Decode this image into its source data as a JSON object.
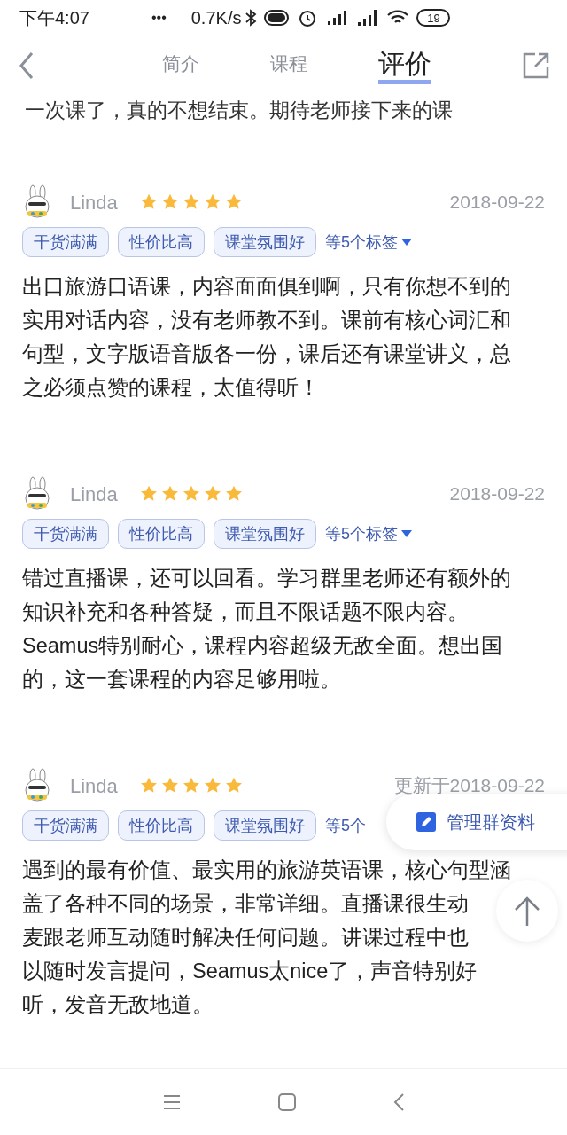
{
  "status_bar": {
    "time": "下午4:07",
    "dots": "•••",
    "speed": "0.7K/s",
    "battery": "19"
  },
  "header": {
    "tabs": [
      {
        "label": "简介",
        "selected": false
      },
      {
        "label": "课程",
        "selected": false
      },
      {
        "label": "评价",
        "selected": true
      }
    ]
  },
  "partial_review": {
    "text": "一次课了，真的不想结束。期待老师接下来的课"
  },
  "reviews": [
    {
      "user": "Linda",
      "stars": 5,
      "date": "2018-09-22",
      "tags": [
        "干货满满",
        "性价比高",
        "课堂氛围好"
      ],
      "more_tags": "等5个标签",
      "lines": [
        "出口旅游口语课，内容面面俱到啊，只有你想不到的",
        "实用对话内容，没有老师教不到。课前有核心词汇和",
        "句型，文字版语音版各一份，课后还有课堂讲义，总",
        "之必须点赞的课程，太值得听！"
      ]
    },
    {
      "user": "Linda",
      "stars": 5,
      "date": "2018-09-22",
      "tags": [
        "干货满满",
        "性价比高",
        "课堂氛围好"
      ],
      "more_tags": "等5个标签",
      "lines": [
        "错过直播课，还可以回看。学习群里老师还有额外的",
        "知识补充和各种答疑，而且不限话题不限内容。",
        "Seamus特别耐心，课程内容超级无敌全面。想出国",
        "的，这一套课程的内容足够用啦。"
      ]
    },
    {
      "user": "Linda",
      "stars": 5,
      "date": "更新于2018-09-22",
      "tags": [
        "干货满满",
        "性价比高",
        "课堂氛围好"
      ],
      "more_tags": "等5个",
      "lines": [
        "遇到的最有价值、最实用的旅游英语课，核心句型涵",
        "盖了各种不同的场景，非常详细。直播课很生动",
        "麦跟老师互动随时解决任何问题。讲课过程中也",
        "以随时发言提问，Seamus太nice了，声音特别好",
        "听，发音无敌地道。"
      ]
    }
  ],
  "float_button": {
    "label": "管理群资料"
  }
}
